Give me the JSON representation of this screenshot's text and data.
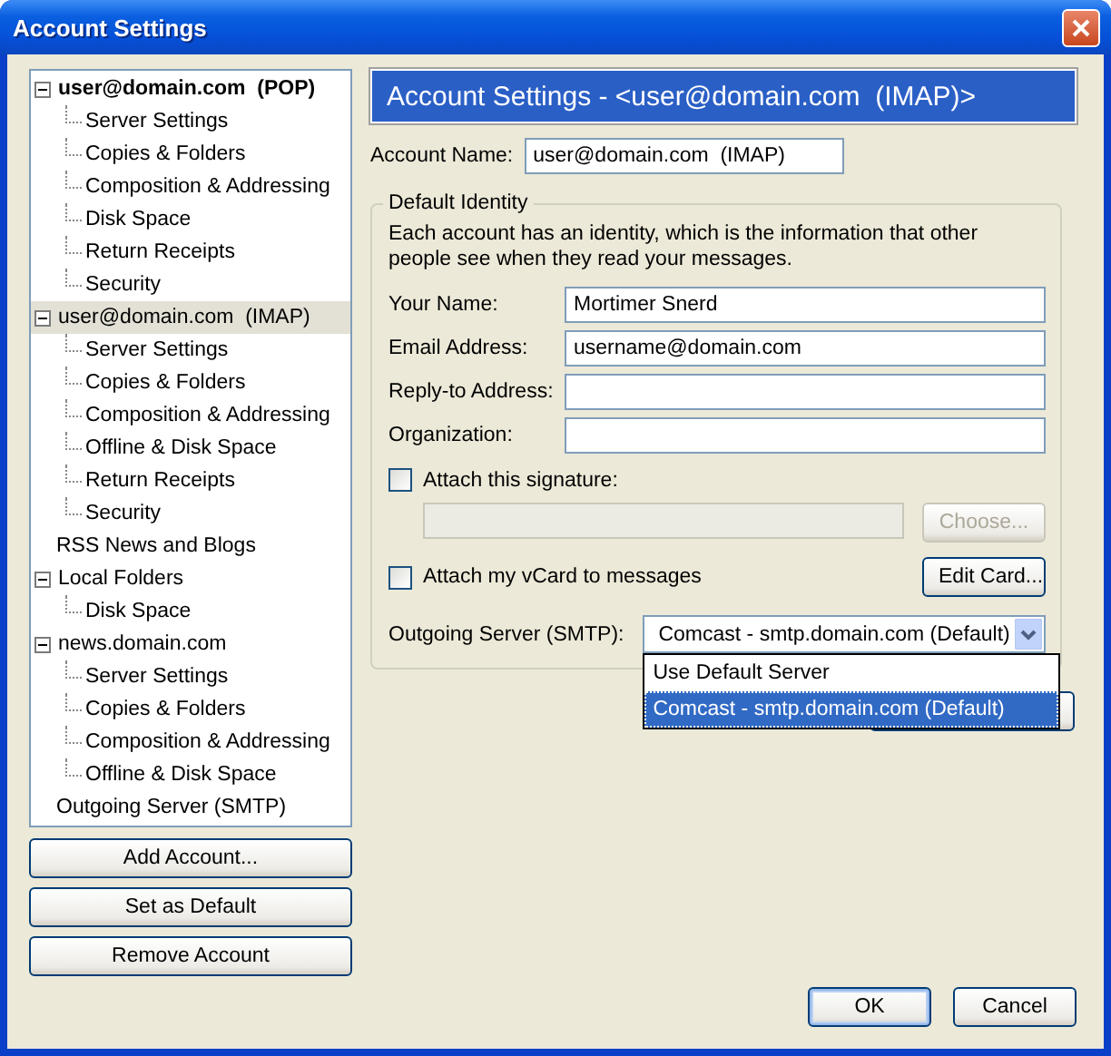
{
  "window": {
    "title": "Account Settings"
  },
  "tree": [
    {
      "label": "user@domain.com  (POP)",
      "default": true,
      "expanded": true,
      "selected": false,
      "children": [
        {
          "label": "Server Settings",
          "selected": false
        },
        {
          "label": "Copies & Folders",
          "selected": false
        },
        {
          "label": "Composition & Addressing",
          "selected": false
        },
        {
          "label": "Disk Space",
          "selected": false
        },
        {
          "label": "Return Receipts",
          "selected": false
        },
        {
          "label": "Security",
          "selected": false
        }
      ]
    },
    {
      "label": "user@domain.com  (IMAP)",
      "default": false,
      "expanded": true,
      "selected": true,
      "children": [
        {
          "label": "Server Settings",
          "selected": false
        },
        {
          "label": "Copies & Folders",
          "selected": false
        },
        {
          "label": "Composition & Addressing",
          "selected": false
        },
        {
          "label": "Offline & Disk Space",
          "selected": false
        },
        {
          "label": "Return Receipts",
          "selected": false
        },
        {
          "label": "Security",
          "selected": false
        }
      ]
    },
    {
      "label": "RSS News and Blogs",
      "default": false,
      "selected": false
    },
    {
      "label": "Local Folders",
      "default": false,
      "expanded": true,
      "selected": false,
      "children": [
        {
          "label": "Disk Space",
          "selected": false
        }
      ]
    },
    {
      "label": "news.domain.com",
      "default": false,
      "expanded": true,
      "selected": false,
      "children": [
        {
          "label": "Server Settings",
          "selected": false
        },
        {
          "label": "Copies & Folders",
          "selected": false
        },
        {
          "label": "Composition & Addressing",
          "selected": false
        },
        {
          "label": "Offline & Disk Space",
          "selected": false
        }
      ]
    },
    {
      "label": "Outgoing Server (SMTP)",
      "default": false,
      "selected": false
    }
  ],
  "account_buttons": [
    "Add Account...",
    "Set as Default",
    "Remove Account"
  ],
  "panel": {
    "header": "Account Settings - <user@domain.com  (IMAP)>",
    "account_name": {
      "label": "Account Name:",
      "value": "user@domain.com  (IMAP)"
    },
    "identity": {
      "legend": "Default Identity",
      "description": "Each account has an identity, which is the information that other people see when they read your messages.",
      "fields": [
        {
          "label": "Your Name:",
          "value": "Mortimer Snerd"
        },
        {
          "label": "Email Address:",
          "value": "username@domain.com"
        },
        {
          "label": "Reply-to Address:"
        },
        {
          "label": "Organization:"
        }
      ],
      "signature": {
        "label": "Attach this signature:",
        "checked": false,
        "disabled": true,
        "button": "Choose..."
      },
      "vcard": {
        "label": "Attach my vCard to messages",
        "checked": false,
        "button": "Edit Card..."
      },
      "smtp": {
        "label": "Outgoing Server (SMTP):",
        "value": "Comcast - smtp.domain.com (Default)",
        "expanded": true,
        "options": [
          {
            "label": "Use Default Server",
            "selected": false
          },
          {
            "label": "Comcast - smtp.domain.com (Default)",
            "selected": true
          }
        ]
      }
    }
  },
  "dialog_buttons": [
    {
      "label": "OK",
      "default": true
    },
    {
      "label": "Cancel",
      "default": false
    }
  ]
}
